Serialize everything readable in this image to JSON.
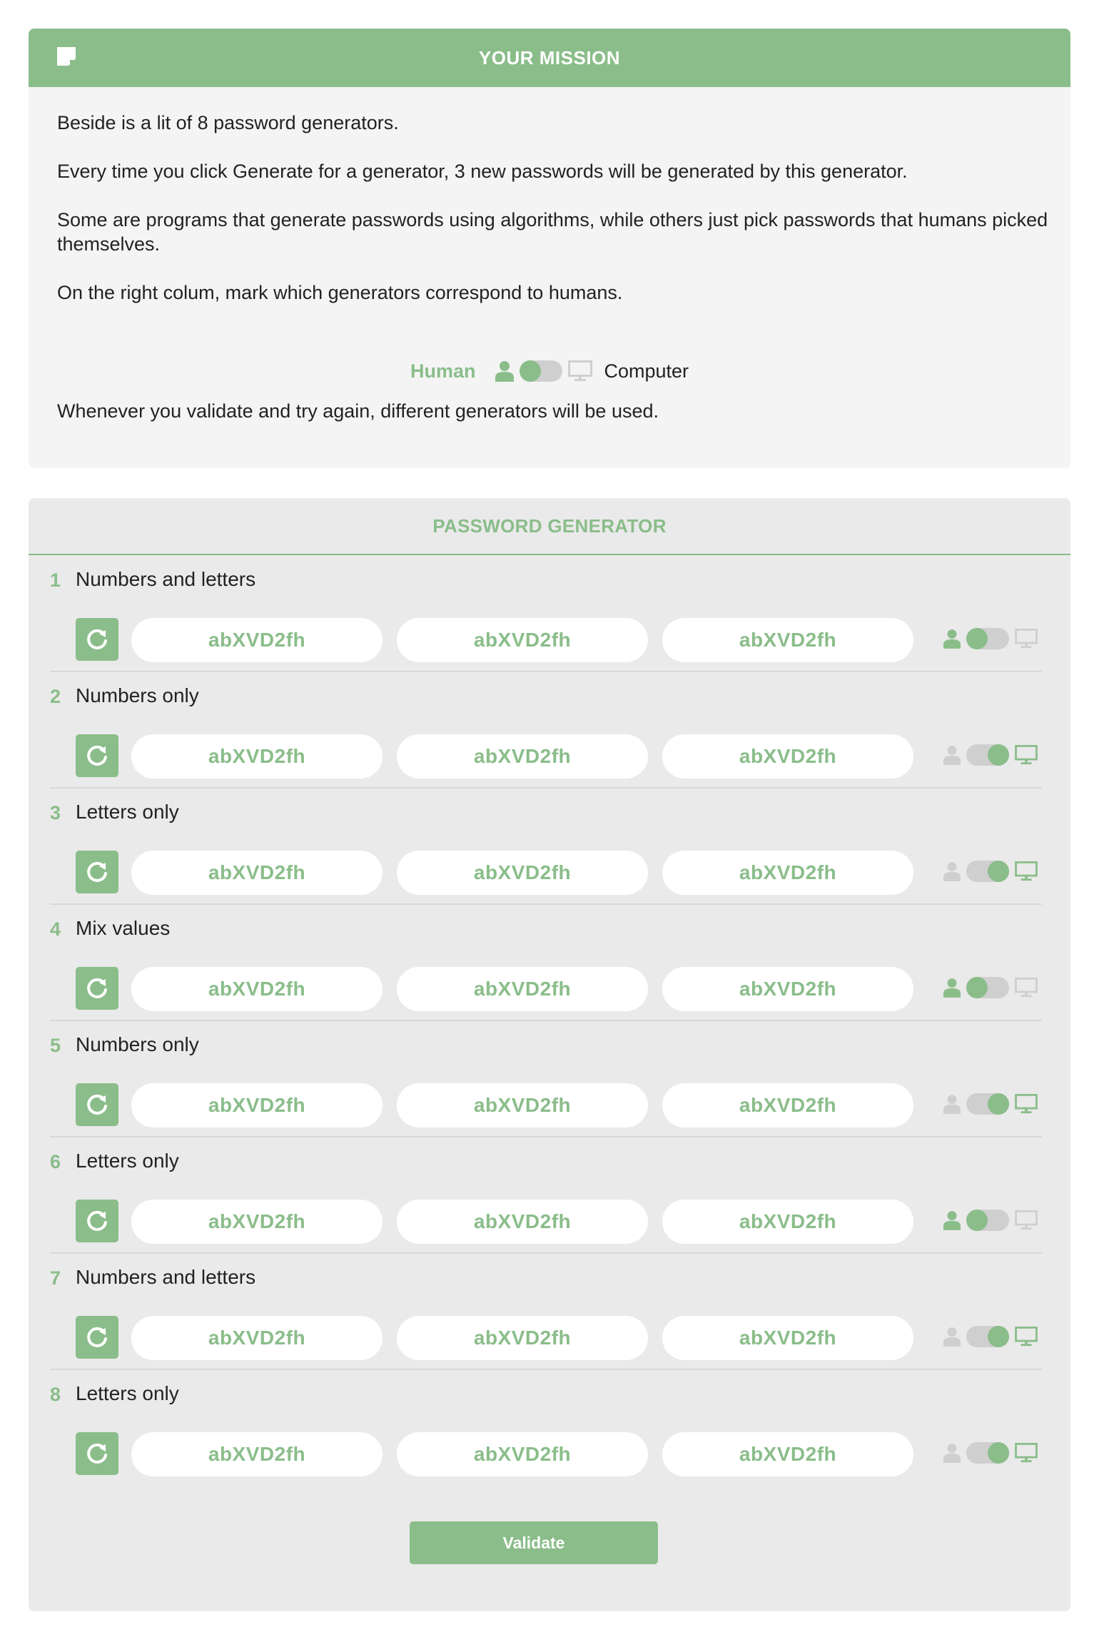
{
  "mission": {
    "title": "YOUR MISSION",
    "icon": "note-icon",
    "paragraphs": [
      "Beside is a lit of 8 password generators.",
      "Every time you click Generate for a generator, 3 new passwords will be generated by this generator.",
      "Some are programs that generate passwords using algorithms, while others just pick passwords that humans picked themselves.",
      "On the right colum, mark which generators correspond to humans."
    ],
    "legend": {
      "human_label": "Human",
      "computer_label": "Computer"
    },
    "footer": "Whenever you validate and try again, different generators will be used."
  },
  "generator": {
    "title": "PASSWORD GENERATOR",
    "rows": [
      {
        "number": "1",
        "label": "Numbers and letters",
        "passwords": [
          "abXVD2fh",
          "abXVD2fh",
          "abXVD2fh"
        ],
        "selection": "human"
      },
      {
        "number": "2",
        "label": "Numbers only",
        "passwords": [
          "abXVD2fh",
          "abXVD2fh",
          "abXVD2fh"
        ],
        "selection": "computer"
      },
      {
        "number": "3",
        "label": "Letters only",
        "passwords": [
          "abXVD2fh",
          "abXVD2fh",
          "abXVD2fh"
        ],
        "selection": "computer"
      },
      {
        "number": "4",
        "label": "Mix values",
        "passwords": [
          "abXVD2fh",
          "abXVD2fh",
          "abXVD2fh"
        ],
        "selection": "human"
      },
      {
        "number": "5",
        "label": "Numbers only",
        "passwords": [
          "abXVD2fh",
          "abXVD2fh",
          "abXVD2fh"
        ],
        "selection": "computer"
      },
      {
        "number": "6",
        "label": "Letters only",
        "passwords": [
          "abXVD2fh",
          "abXVD2fh",
          "abXVD2fh"
        ],
        "selection": "human"
      },
      {
        "number": "7",
        "label": "Numbers and letters",
        "passwords": [
          "abXVD2fh",
          "abXVD2fh",
          "abXVD2fh"
        ],
        "selection": "computer"
      },
      {
        "number": "8",
        "label": "Letters only",
        "passwords": [
          "abXVD2fh",
          "abXVD2fh",
          "abXVD2fh"
        ],
        "selection": "computer"
      }
    ],
    "validate_label": "Validate"
  },
  "colors": {
    "accent": "#8abd8a",
    "inactive_icon": "#cfcfcf",
    "card_bg": "#f4f4f4",
    "panel_bg": "#eaeaea"
  }
}
